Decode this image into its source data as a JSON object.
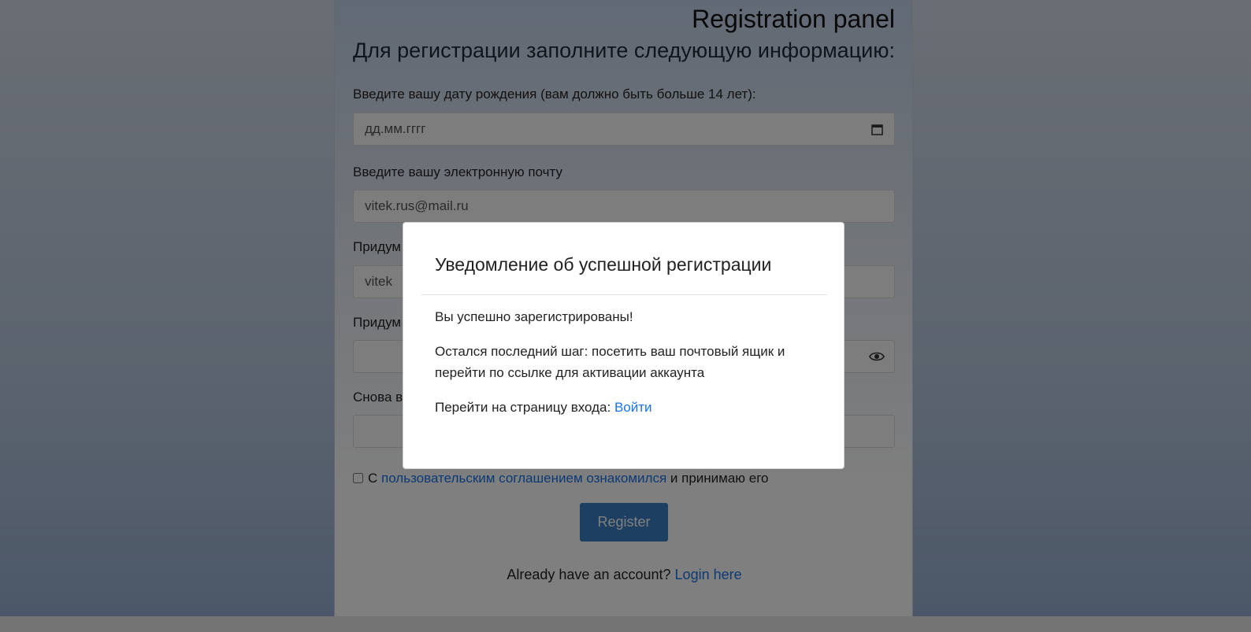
{
  "panel": {
    "title": "Registration panel",
    "subtitle": "Для регистрации заполните следующую информацию:",
    "birth_label": "Введите вашу дату рождения (вам должно быть больше 14 лет):",
    "birth_placeholder": "дд.мм.гггг",
    "email_label": "Введите вашу электронную почту",
    "email_value": "vitek.rus@mail.ru",
    "login_label": "Придум",
    "login_value": "vitek",
    "password_label": "Придум",
    "password_value": "",
    "confirm_label": "Снова в",
    "confirm_value": "",
    "agree_prefix": "С",
    "agree_link": "пользовательским соглашением ознакомился",
    "agree_suffix": "и принимаю его",
    "register_label": "Register",
    "already_text": "Already have an account?",
    "login_link": "Login here"
  },
  "modal": {
    "title": "Уведомление об успешной регистрации",
    "success_text": "Вы успешно зарегистрированы!",
    "step_text": "Остался последний шаг: посетить ваш почтовый ящик и перейти по ссылке для активации аккаунта",
    "goto_text": "Перейти на страницу входа:",
    "goto_link": "Войти"
  },
  "icons": {
    "calendar": "calendar-icon",
    "eye": "eye-icon"
  },
  "colors": {
    "link": "#1a73e8",
    "register_button": "#3b7fc4",
    "overlay": "rgba(0,0,0,0.5)"
  }
}
